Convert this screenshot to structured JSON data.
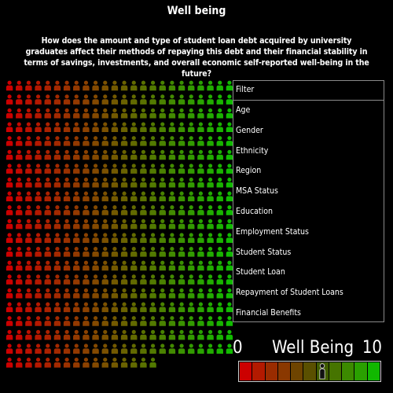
{
  "header": {
    "title": "Well being",
    "question": "How does the amount and type of student loan debt acquired by university graduates affect their methods of repaying this debt and their financial stability in terms of savings, investments, and overall economic self-reported well-being in the future?"
  },
  "filter": {
    "title": "Filter",
    "items": [
      {
        "label": "Age"
      },
      {
        "label": "Gender"
      },
      {
        "label": "Ethnicity"
      },
      {
        "label": "Region"
      },
      {
        "label": "MSA Status"
      },
      {
        "label": "Education"
      },
      {
        "label": "Employment Status"
      },
      {
        "label": "Student Status"
      },
      {
        "label": "Student Loan"
      },
      {
        "label": "Repayment of Student Loans"
      },
      {
        "label": "Financial Benefits"
      }
    ]
  },
  "legend": {
    "min_label": "0",
    "title": "Well Being",
    "max_label": "10",
    "marker_value": 6,
    "marker_icon": "person-marker-icon",
    "scale_colors": [
      "#cc0000",
      "#b31a00",
      "#9a2c00",
      "#8a3800",
      "#6e4400",
      "#5a5000",
      "#3f5c00",
      "#467400",
      "#3c8a00",
      "#2aa000",
      "#11b800"
    ]
  },
  "people_grid": {
    "icon": "person-icon",
    "rows": 21,
    "columns": 24,
    "last_row_count": 16,
    "color_low": "#cc0000",
    "color_high": "#11bb00"
  }
}
